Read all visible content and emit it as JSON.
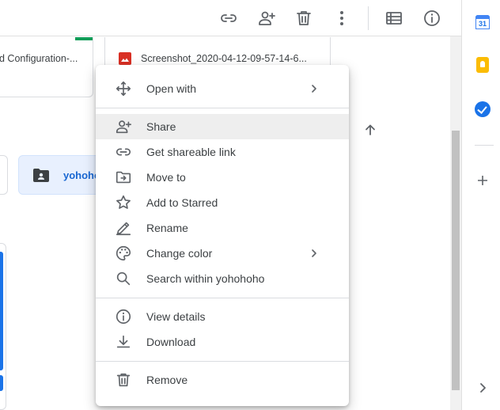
{
  "toolbar": {
    "buttons": [
      {
        "name": "link-icon",
        "label": "Get shareable link"
      },
      {
        "name": "add-person-icon",
        "label": "Share"
      },
      {
        "name": "trash-icon",
        "label": "Remove"
      },
      {
        "name": "more-vert-icon",
        "label": "More actions"
      },
      {
        "name": "list-view-icon",
        "label": "List layout"
      },
      {
        "name": "info-icon",
        "label": "View details"
      }
    ]
  },
  "files": {
    "card_1_title": "d Configuration-...",
    "card_2_title": "Screenshot_2020-04-12-09-57-14-6...",
    "folder_label": "yohoho"
  },
  "context_menu": {
    "groups": [
      [
        {
          "label": "Open with",
          "icon": "open-with-icon",
          "submenu": true
        }
      ],
      [
        {
          "label": "Share",
          "icon": "add-person-icon",
          "highlighted": true
        },
        {
          "label": "Get shareable link",
          "icon": "link-icon"
        },
        {
          "label": "Move to",
          "icon": "move-to-folder-icon"
        },
        {
          "label": "Add to Starred",
          "icon": "star-icon"
        },
        {
          "label": "Rename",
          "icon": "pencil-icon"
        },
        {
          "label": "Change color",
          "icon": "palette-icon",
          "submenu": true
        },
        {
          "label": "Search within yohohoho",
          "icon": "search-icon"
        }
      ],
      [
        {
          "label": "View details",
          "icon": "info-icon"
        },
        {
          "label": "Download",
          "icon": "download-icon"
        }
      ],
      [
        {
          "label": "Remove",
          "icon": "trash-icon"
        }
      ]
    ]
  },
  "side_panel": {
    "apps": [
      {
        "name": "calendar-icon",
        "label": "Calendar",
        "badge": "31"
      },
      {
        "name": "keep-icon",
        "label": "Keep"
      },
      {
        "name": "tasks-icon",
        "label": "Tasks"
      }
    ]
  },
  "colors": {
    "accent_blue": "#1a73e8",
    "folder_chip_bg": "#e8f0fe",
    "folder_text": "#1967d2",
    "icon_gray": "#5f6368",
    "highlight_bg": "#eeeeee",
    "sheet_green": "#0f9d58",
    "image_red": "#d93025"
  }
}
